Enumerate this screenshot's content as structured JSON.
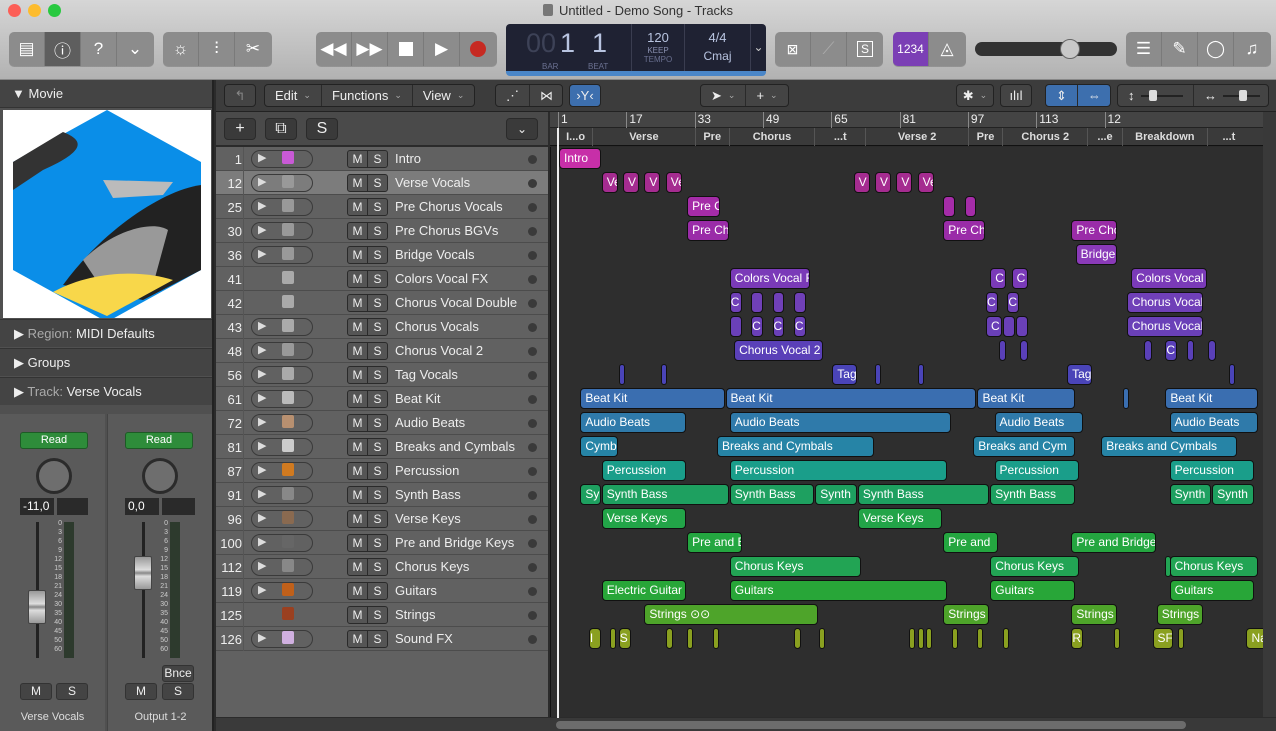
{
  "window": {
    "title": "Untitled - Demo Song - Tracks"
  },
  "toolbar": {
    "left_buttons": [
      "library-icon",
      "inspector-icon",
      "quick-help-icon",
      "toolbar-toggle-icon"
    ],
    "mid_buttons": [
      "smart-controls-icon",
      "mixer-icon",
      "editors-icon"
    ],
    "transport": [
      "rewind",
      "fast-forward",
      "stop",
      "play",
      "record"
    ],
    "lcd": {
      "bar_prefix": "00",
      "bar": "1",
      "beat": "1",
      "bar_label": "BAR",
      "beat_label": "BEAT",
      "tempo": "120",
      "tempo_mode": "KEEP",
      "tempo_label": "TEMPO",
      "signature": "4/4",
      "key": "Cmaj"
    },
    "right_group1": [
      "replace-icon",
      "tuner-icon",
      "solo-icon"
    ],
    "count_in_label": "1234",
    "master_volume_fraction": 0.7,
    "right_group2": [
      "list-editors-icon",
      "note-pad-icon",
      "loop-browser-icon",
      "browsers-icon"
    ],
    "colors": {
      "count_in": "#7b3fb5",
      "record": "#c62a22",
      "lcd_bg": "#1f2233"
    }
  },
  "inspector": {
    "movie_header": "Movie",
    "region_label": "Region:",
    "region_value": "MIDI Defaults",
    "groups_label": "Groups",
    "track_label": "Track:",
    "track_value": "Verse Vocals",
    "strips": [
      {
        "name": "Verse Vocals",
        "automation": "Read",
        "volume": "-11,0",
        "mute": "M",
        "solo": "S"
      },
      {
        "name": "Output 1-2",
        "automation": "Read",
        "volume": "0,0",
        "mute": "M",
        "solo": "S",
        "bounce": "Bnce"
      }
    ],
    "meter_scale": [
      "0",
      "3",
      "6",
      "9",
      "12",
      "15",
      "18",
      "21",
      "24",
      "30",
      "35",
      "40",
      "45",
      "50",
      "60"
    ]
  },
  "tracks_toolbar": {
    "menus": [
      "Edit",
      "Functions",
      "View"
    ],
    "tool_pointer": "pointer-tool",
    "tool_marquee": "marquee-tool"
  },
  "track_header_buttons": {
    "add": "+",
    "dup": "duplicate-track",
    "solo": "S"
  },
  "tracks": [
    {
      "num": "1",
      "name": "Intro",
      "icon": "#c95ad6",
      "has_play": true
    },
    {
      "num": "12",
      "name": "Verse Vocals",
      "icon": "#999",
      "has_play": true,
      "selected": true
    },
    {
      "num": "25",
      "name": "Pre Chorus Vocals",
      "icon": "#999",
      "has_play": true
    },
    {
      "num": "30",
      "name": "Pre Chorus BGVs",
      "icon": "#999",
      "has_play": true
    },
    {
      "num": "36",
      "name": "Bridge Vocals",
      "icon": "#999",
      "has_play": true
    },
    {
      "num": "41",
      "name": "Colors Vocal FX",
      "icon": "#aaa",
      "has_play": false
    },
    {
      "num": "42",
      "name": "Chorus Vocal Double",
      "icon": "#aaa",
      "has_play": false
    },
    {
      "num": "43",
      "name": "Chorus Vocals",
      "icon": "#aaa",
      "has_play": true
    },
    {
      "num": "48",
      "name": "Chorus Vocal 2",
      "icon": "#999",
      "has_play": true
    },
    {
      "num": "56",
      "name": "Tag Vocals",
      "icon": "#aaa",
      "has_play": true
    },
    {
      "num": "61",
      "name": "Beat Kit",
      "icon": "#bbb",
      "has_play": true
    },
    {
      "num": "72",
      "name": "Audio Beats",
      "icon": "#b89070",
      "has_play": true
    },
    {
      "num": "81",
      "name": "Breaks and Cymbals",
      "icon": "#ccc",
      "has_play": true
    },
    {
      "num": "87",
      "name": "Percussion",
      "icon": "#d07a20",
      "has_play": true
    },
    {
      "num": "91",
      "name": "Synth Bass",
      "icon": "#888",
      "has_play": true
    },
    {
      "num": "96",
      "name": "Verse Keys",
      "icon": "#8a6a50",
      "has_play": true
    },
    {
      "num": "100",
      "name": "Pre and Bridge Keys",
      "icon": "#666",
      "has_play": true
    },
    {
      "num": "112",
      "name": "Chorus Keys",
      "icon": "#888",
      "has_play": true
    },
    {
      "num": "119",
      "name": "Guitars",
      "icon": "#c0601a",
      "has_play": true
    },
    {
      "num": "125",
      "name": "Strings",
      "icon": "#9a4020",
      "has_play": false
    },
    {
      "num": "126",
      "name": "Sound FX",
      "icon": "#d0b0e0",
      "has_play": true
    }
  ],
  "ruler": [
    "1",
    "17",
    "33",
    "49",
    "65",
    "81",
    "97",
    "113",
    "12"
  ],
  "markers": [
    "I...o",
    "Verse",
    "Pre",
    "Chorus",
    "...t",
    "Verse 2",
    "Pre",
    "Chorus  2",
    "...e",
    "Breakdown",
    "...t"
  ],
  "regions": [
    {
      "row": 0,
      "bar": 1,
      "len": 10,
      "label": "Intro",
      "color": "#c72fa8"
    },
    {
      "row": 1,
      "bar": 11,
      "len": 4,
      "label": "Ve",
      "color": "#a52c90"
    },
    {
      "row": 1,
      "bar": 16,
      "len": 4,
      "label": "V",
      "color": "#a52c90"
    },
    {
      "row": 1,
      "bar": 21,
      "len": 4,
      "label": "V",
      "color": "#a52c90"
    },
    {
      "row": 1,
      "bar": 26,
      "len": 4,
      "label": "Ve",
      "color": "#a52c90"
    },
    {
      "row": 1,
      "bar": 70,
      "len": 4,
      "label": "V",
      "color": "#a52c90"
    },
    {
      "row": 1,
      "bar": 75,
      "len": 4,
      "label": "V",
      "color": "#a52c90"
    },
    {
      "row": 1,
      "bar": 80,
      "len": 4,
      "label": "V",
      "color": "#a52c90"
    },
    {
      "row": 1,
      "bar": 85,
      "len": 4,
      "label": "Ve",
      "color": "#a52c90"
    },
    {
      "row": 2,
      "bar": 31,
      "len": 8,
      "label": "Pre C",
      "color": "#a52ca8"
    },
    {
      "row": 2,
      "bar": 91,
      "len": 3,
      "label": "",
      "color": "#a52ca8"
    },
    {
      "row": 2,
      "bar": 96,
      "len": 3,
      "label": "",
      "color": "#a52ca8"
    },
    {
      "row": 3,
      "bar": 31,
      "len": 10,
      "label": "Pre Ch",
      "color": "#9a2ca8"
    },
    {
      "row": 3,
      "bar": 91,
      "len": 10,
      "label": "Pre Ch",
      "color": "#9a2ca8"
    },
    {
      "row": 3,
      "bar": 121,
      "len": 11,
      "label": "Pre Cho",
      "color": "#9a2ca8"
    },
    {
      "row": 4,
      "bar": 122,
      "len": 10,
      "label": "Bridge",
      "color": "#8a3ab8"
    },
    {
      "row": 5,
      "bar": 41,
      "len": 19,
      "label": "Colors Vocal F",
      "color": "#7a3ab8"
    },
    {
      "row": 5,
      "bar": 102,
      "len": 4,
      "label": "C",
      "color": "#7a3ab8"
    },
    {
      "row": 5,
      "bar": 107,
      "len": 4,
      "label": "C",
      "color": "#7a3ab8"
    },
    {
      "row": 5,
      "bar": 135,
      "len": 18,
      "label": "Colors Vocal F",
      "color": "#7a3ab8"
    },
    {
      "row": 6,
      "bar": 41,
      "len": 3,
      "label": "C",
      "color": "#7040b8"
    },
    {
      "row": 6,
      "bar": 46,
      "len": 3,
      "label": "",
      "color": "#7040b8"
    },
    {
      "row": 6,
      "bar": 51,
      "len": 3,
      "label": "",
      "color": "#7040b8"
    },
    {
      "row": 6,
      "bar": 56,
      "len": 3,
      "label": "",
      "color": "#7040b8"
    },
    {
      "row": 6,
      "bar": 101,
      "len": 3,
      "label": "C",
      "color": "#7040b8"
    },
    {
      "row": 6,
      "bar": 106,
      "len": 3,
      "label": "C",
      "color": "#7040b8"
    },
    {
      "row": 6,
      "bar": 134,
      "len": 18,
      "label": "Chorus Vocal",
      "color": "#7040b8"
    },
    {
      "row": 7,
      "bar": 41,
      "len": 3,
      "label": "",
      "color": "#6a40b8"
    },
    {
      "row": 7,
      "bar": 46,
      "len": 3,
      "label": "C",
      "color": "#6a40b8"
    },
    {
      "row": 7,
      "bar": 51,
      "len": 3,
      "label": "C",
      "color": "#6a40b8"
    },
    {
      "row": 7,
      "bar": 56,
      "len": 3,
      "label": "C",
      "color": "#6a40b8"
    },
    {
      "row": 7,
      "bar": 101,
      "len": 4,
      "label": "C",
      "color": "#6a40b8"
    },
    {
      "row": 7,
      "bar": 105,
      "len": 3,
      "label": "",
      "color": "#6a40b8"
    },
    {
      "row": 7,
      "bar": 108,
      "len": 3,
      "label": "",
      "color": "#6a40b8"
    },
    {
      "row": 7,
      "bar": 134,
      "len": 18,
      "label": "Chorus Vocals",
      "color": "#6a40b8"
    },
    {
      "row": 8,
      "bar": 42,
      "len": 21,
      "label": "Chorus Vocal 2",
      "color": "#5a40b8"
    },
    {
      "row": 8,
      "bar": 104,
      "len": 2,
      "label": "",
      "color": "#5a40b8"
    },
    {
      "row": 8,
      "bar": 109,
      "len": 2,
      "label": "",
      "color": "#5a40b8"
    },
    {
      "row": 8,
      "bar": 138,
      "len": 2,
      "label": "",
      "color": "#5a40b8"
    },
    {
      "row": 8,
      "bar": 143,
      "len": 3,
      "label": "C",
      "color": "#5a40b8"
    },
    {
      "row": 8,
      "bar": 148,
      "len": 2,
      "label": "",
      "color": "#5a40b8"
    },
    {
      "row": 8,
      "bar": 153,
      "len": 2,
      "label": "",
      "color": "#5a40b8"
    },
    {
      "row": 9,
      "bar": 15,
      "len": 1,
      "label": "",
      "color": "#4a44b8"
    },
    {
      "row": 9,
      "bar": 25,
      "len": 1,
      "label": "",
      "color": "#4a44b8"
    },
    {
      "row": 9,
      "bar": 65,
      "len": 6,
      "label": "Tag",
      "color": "#4a44b8"
    },
    {
      "row": 9,
      "bar": 75,
      "len": 1,
      "label": "",
      "color": "#4a44b8"
    },
    {
      "row": 9,
      "bar": 85,
      "len": 1,
      "label": "",
      "color": "#4a44b8"
    },
    {
      "row": 9,
      "bar": 120,
      "len": 6,
      "label": "Tag",
      "color": "#4a44b8"
    },
    {
      "row": 9,
      "bar": 158,
      "len": 1,
      "label": "",
      "color": "#4a44b8"
    },
    {
      "row": 10,
      "bar": 6,
      "len": 34,
      "label": "Beat Kit",
      "color": "#3a6eb0"
    },
    {
      "row": 10,
      "bar": 40,
      "len": 59,
      "label": "Beat Kit",
      "color": "#3a6eb0"
    },
    {
      "row": 10,
      "bar": 99,
      "len": 23,
      "label": "Beat Kit",
      "color": "#3a6eb0"
    },
    {
      "row": 10,
      "bar": 133,
      "len": 1,
      "label": "",
      "color": "#3a6eb0"
    },
    {
      "row": 10,
      "bar": 143,
      "len": 22,
      "label": "Beat Kit",
      "color": "#3a6eb0"
    },
    {
      "row": 11,
      "bar": 6,
      "len": 25,
      "label": "Audio Beats",
      "color": "#2f7aaa"
    },
    {
      "row": 11,
      "bar": 41,
      "len": 52,
      "label": "Audio Beats",
      "color": "#2f7aaa"
    },
    {
      "row": 11,
      "bar": 103,
      "len": 21,
      "label": "Audio Beats",
      "color": "#2f7aaa"
    },
    {
      "row": 11,
      "bar": 144,
      "len": 21,
      "label": "Audio Beats",
      "color": "#2f7aaa"
    },
    {
      "row": 12,
      "bar": 6,
      "len": 9,
      "label": "Cymb",
      "color": "#2684a6"
    },
    {
      "row": 12,
      "bar": 38,
      "len": 37,
      "label": "Breaks and Cymbals",
      "color": "#2684a6"
    },
    {
      "row": 12,
      "bar": 98,
      "len": 24,
      "label": "Breaks and Cym",
      "color": "#2684a6"
    },
    {
      "row": 12,
      "bar": 128,
      "len": 32,
      "label": "Breaks and Cymbals",
      "color": "#2684a6"
    },
    {
      "row": 13,
      "bar": 11,
      "len": 20,
      "label": "Percussion",
      "color": "#1a9e8a"
    },
    {
      "row": 13,
      "bar": 41,
      "len": 51,
      "label": "Percussion",
      "color": "#1a9e8a"
    },
    {
      "row": 13,
      "bar": 103,
      "len": 20,
      "label": "Percussion",
      "color": "#1a9e8a"
    },
    {
      "row": 13,
      "bar": 144,
      "len": 20,
      "label": "Percussion",
      "color": "#1a9e8a"
    },
    {
      "row": 14,
      "bar": 6,
      "len": 5,
      "label": "Sy",
      "color": "#1ea060"
    },
    {
      "row": 14,
      "bar": 11,
      "len": 30,
      "label": "Synth Bass",
      "color": "#1ea060"
    },
    {
      "row": 14,
      "bar": 41,
      "len": 20,
      "label": "Synth Bass",
      "color": "#1ea060"
    },
    {
      "row": 14,
      "bar": 61,
      "len": 10,
      "label": "Synth",
      "color": "#1ea060"
    },
    {
      "row": 14,
      "bar": 71,
      "len": 31,
      "label": "Synth Bass",
      "color": "#1ea060"
    },
    {
      "row": 14,
      "bar": 102,
      "len": 20,
      "label": "Synth Bass",
      "color": "#1ea060"
    },
    {
      "row": 14,
      "bar": 144,
      "len": 10,
      "label": "Synth",
      "color": "#1ea060"
    },
    {
      "row": 14,
      "bar": 154,
      "len": 10,
      "label": "Synth",
      "color": "#1ea060"
    },
    {
      "row": 15,
      "bar": 11,
      "len": 20,
      "label": "Verse Keys",
      "color": "#22a448"
    },
    {
      "row": 15,
      "bar": 71,
      "len": 20,
      "label": "Verse Keys",
      "color": "#22a448"
    },
    {
      "row": 16,
      "bar": 31,
      "len": 13,
      "label": "Pre and B",
      "color": "#24a640"
    },
    {
      "row": 16,
      "bar": 91,
      "len": 13,
      "label": "Pre and",
      "color": "#24a640"
    },
    {
      "row": 16,
      "bar": 121,
      "len": 20,
      "label": "Pre and Bridge",
      "color": "#24a640"
    },
    {
      "row": 17,
      "bar": 41,
      "len": 31,
      "label": "Chorus Keys",
      "color": "#22a454"
    },
    {
      "row": 17,
      "bar": 102,
      "len": 21,
      "label": "Chorus Keys",
      "color": "#22a454"
    },
    {
      "row": 17,
      "bar": 143,
      "len": 1,
      "label": "",
      "color": "#22a454"
    },
    {
      "row": 17,
      "bar": 144,
      "len": 21,
      "label": "Chorus Keys",
      "color": "#22a454"
    },
    {
      "row": 18,
      "bar": 11,
      "len": 20,
      "label": "Electric Guitar",
      "color": "#28a638"
    },
    {
      "row": 18,
      "bar": 41,
      "len": 51,
      "label": "Guitars",
      "color": "#28a638"
    },
    {
      "row": 18,
      "bar": 102,
      "len": 20,
      "label": "Guitars",
      "color": "#28a638"
    },
    {
      "row": 18,
      "bar": 144,
      "len": 20,
      "label": "Guitars",
      "color": "#28a638"
    },
    {
      "row": 19,
      "bar": 21,
      "len": 41,
      "label": "Strings ⊙⊙",
      "color": "#4ea42a"
    },
    {
      "row": 19,
      "bar": 91,
      "len": 11,
      "label": "Strings",
      "color": "#4ea42a"
    },
    {
      "row": 19,
      "bar": 121,
      "len": 11,
      "label": "Strings",
      "color": "#4ea42a"
    },
    {
      "row": 19,
      "bar": 141,
      "len": 11,
      "label": "Strings",
      "color": "#4ea42a"
    },
    {
      "row": 20,
      "bar": 8,
      "len": 3,
      "label": "I",
      "color": "#8aa020"
    },
    {
      "row": 20,
      "bar": 13,
      "len": 1,
      "label": "",
      "color": "#8aa020"
    },
    {
      "row": 20,
      "bar": 15,
      "len": 3,
      "label": "S",
      "color": "#8aa020"
    },
    {
      "row": 20,
      "bar": 26,
      "len": 2,
      "label": "",
      "color": "#8aa020"
    },
    {
      "row": 20,
      "bar": 31,
      "len": 1,
      "label": "",
      "color": "#8aa020"
    },
    {
      "row": 20,
      "bar": 37,
      "len": 1,
      "label": "",
      "color": "#8aa020"
    },
    {
      "row": 20,
      "bar": 56,
      "len": 2,
      "label": "",
      "color": "#8aa020"
    },
    {
      "row": 20,
      "bar": 62,
      "len": 1,
      "label": "",
      "color": "#8aa020"
    },
    {
      "row": 20,
      "bar": 83,
      "len": 1,
      "label": "",
      "color": "#8aa020"
    },
    {
      "row": 20,
      "bar": 85,
      "len": 1,
      "label": "",
      "color": "#8aa020"
    },
    {
      "row": 20,
      "bar": 87,
      "len": 1,
      "label": "",
      "color": "#8aa020"
    },
    {
      "row": 20,
      "bar": 93,
      "len": 1,
      "label": "",
      "color": "#8aa020"
    },
    {
      "row": 20,
      "bar": 99,
      "len": 1,
      "label": "",
      "color": "#8aa020"
    },
    {
      "row": 20,
      "bar": 105,
      "len": 1,
      "label": "",
      "color": "#8aa020"
    },
    {
      "row": 20,
      "bar": 121,
      "len": 3,
      "label": "R",
      "color": "#8aa020"
    },
    {
      "row": 20,
      "bar": 131,
      "len": 1,
      "label": "",
      "color": "#8aa020"
    },
    {
      "row": 20,
      "bar": 140,
      "len": 5,
      "label": "SF",
      "color": "#8aa020"
    },
    {
      "row": 20,
      "bar": 146,
      "len": 1,
      "label": "",
      "color": "#8aa020"
    },
    {
      "row": 20,
      "bar": 162,
      "len": 5,
      "label": "Na",
      "color": "#8aa020"
    }
  ]
}
